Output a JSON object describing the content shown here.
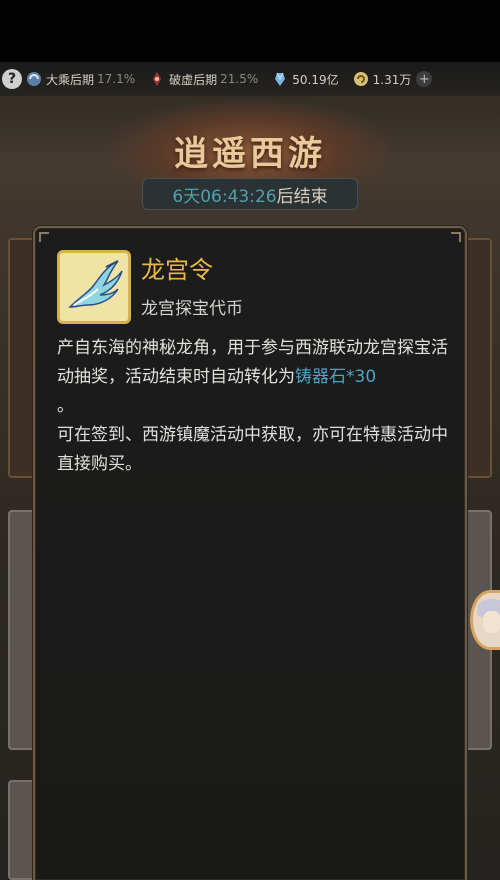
{
  "status_bar": {
    "help_label": "?",
    "realm1": {
      "label": "大乘后期",
      "pct": "17.1%"
    },
    "realm2": {
      "label": "破虚后期",
      "pct": "21.5%"
    },
    "spirit": {
      "label": "50.19亿"
    },
    "currency": {
      "label": "1.31万",
      "add": "+"
    }
  },
  "event": {
    "title": "逍遥西游",
    "timer_value": "6天06:43:26",
    "timer_suffix": "后结束"
  },
  "item": {
    "name": "龙宫令",
    "subtitle": "龙宫探宝代币",
    "desc_line1_a": "产自东海的神秘龙角，用于参与西游联动龙宫探宝活动抽奖，活动结束时自动转化为",
    "desc_line1_link": "铸器石*30",
    "desc_line1_b": "。",
    "desc_line2": "可在签到、西游镇魔活动中获取，亦可在特惠活动中直接购买。"
  },
  "colors": {
    "accent_gold": "#e8b948",
    "link_blue": "#4aa6c8",
    "timer_cyan": "#4fa0b0"
  }
}
